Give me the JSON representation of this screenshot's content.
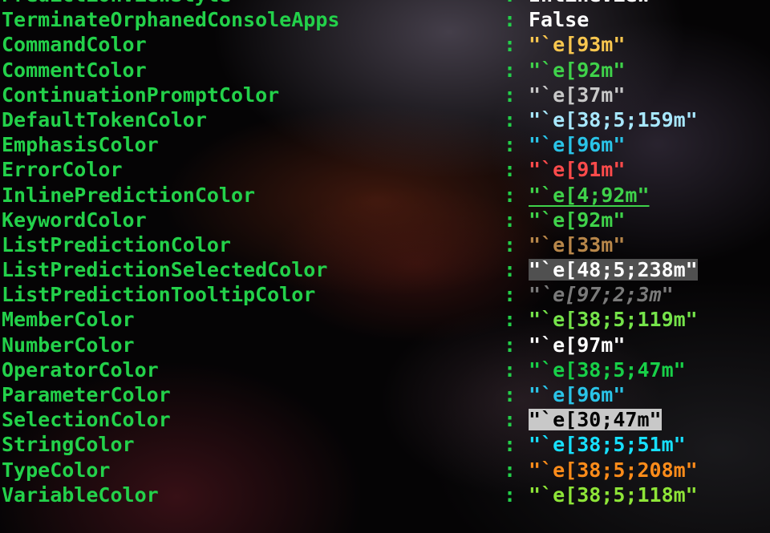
{
  "terminal": {
    "lines": [
      {
        "prop": "PredictionViewStyle",
        "value": "InlineView",
        "style": "white"
      },
      {
        "prop": "TerminateOrphanedConsoleApps",
        "value": "False",
        "style": "white"
      },
      {
        "prop": "CommandColor",
        "value": "\"`e[93m\"",
        "style": "bold-yellow"
      },
      {
        "prop": "CommentColor",
        "value": "\"`e[92m\"",
        "style": "green"
      },
      {
        "prop": "ContinuationPromptColor",
        "value": "\"`e[37m\"",
        "style": "gray"
      },
      {
        "prop": "DefaultTokenColor",
        "value": "\"`e[38;5;159m\"",
        "style": "light-blue"
      },
      {
        "prop": "EmphasisColor",
        "value": "\"`e[96m\"",
        "style": "cyan"
      },
      {
        "prop": "ErrorColor",
        "value": "\"`e[91m\"",
        "style": "red"
      },
      {
        "prop": "InlinePredictionColor",
        "value": "\"`e[4;92m\"",
        "style": "underline-green"
      },
      {
        "prop": "KeywordColor",
        "value": "\"`e[92m\"",
        "style": "green"
      },
      {
        "prop": "ListPredictionColor",
        "value": "\"`e[33m\"",
        "style": "tan"
      },
      {
        "prop": "ListPredictionSelectedColor",
        "value": "\"`e[48;5;238m\"",
        "style": "sel-bg"
      },
      {
        "prop": "ListPredictionTooltipColor",
        "value": "\"`e[97;2;3m\"",
        "style": "italic-gray"
      },
      {
        "prop": "MemberColor",
        "value": "\"`e[38;5;119m\"",
        "style": "green2"
      },
      {
        "prop": "NumberColor",
        "value": "\"`e[97m\"",
        "style": "white"
      },
      {
        "prop": "OperatorColor",
        "value": "\"`e[38;5;47m\"",
        "style": "bright-green"
      },
      {
        "prop": "ParameterColor",
        "value": "\"`e[96m\"",
        "style": "cyan"
      },
      {
        "prop": "SelectionColor",
        "value": "\"`e[30;47m\"",
        "style": "inverse"
      },
      {
        "prop": "StringColor",
        "value": "\"`e[38;5;51m\"",
        "style": "aqua"
      },
      {
        "prop": "TypeColor",
        "value": "\"`e[38;5;208m\"",
        "style": "orange"
      },
      {
        "prop": "VariableColor",
        "value": "\"`e[38;5;118m\"",
        "style": "lime"
      }
    ],
    "separator": ":"
  },
  "colors": {
    "property_name": "#23d14a",
    "background": "#050405"
  }
}
